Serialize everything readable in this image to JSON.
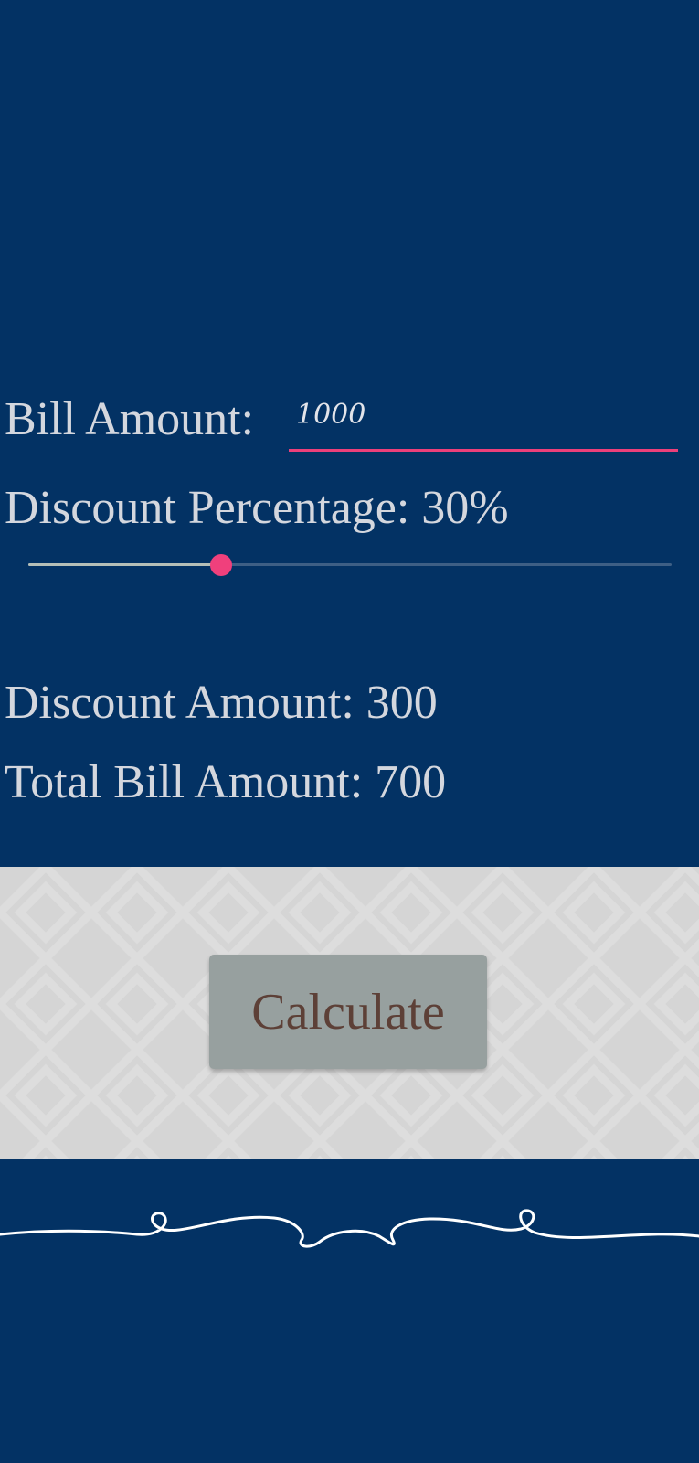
{
  "bill": {
    "label": "Bill Amount:",
    "value": "1000",
    "placeholder": ""
  },
  "discount": {
    "label": "Discount Percentage: 30%",
    "slider_value_percent": 30
  },
  "results": {
    "discount_amount": "Discount Amount: 300",
    "total_bill_amount": "Total Bill Amount: 700"
  },
  "actions": {
    "calculate_label": "Calculate"
  },
  "icons": {
    "divider": "swirl-divider-icon"
  },
  "colors": {
    "background": "#033264",
    "accent": "#ec407a",
    "text": "#d4d7de",
    "button": "#97a09f",
    "button_text": "#5d4037",
    "panel": "#d5d5d5"
  }
}
